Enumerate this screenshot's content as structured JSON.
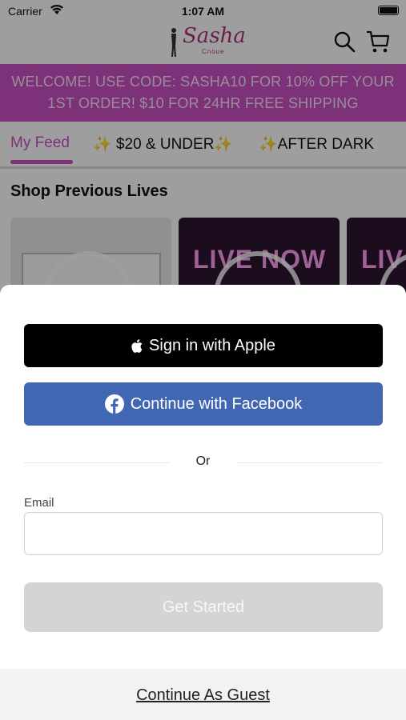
{
  "status_bar": {
    "carrier": "Carrier",
    "time": "1:07 AM"
  },
  "header": {
    "logo_text": "Sasha",
    "logo_subtext": "Cnoue"
  },
  "promo": {
    "line1": "WELCOME! USE CODE: SASHA10 FOR 10% OFF YOUR",
    "line2": "1ST ORDER! $10 FOR 24HR FREE SHIPPING"
  },
  "tabs": [
    {
      "label": "My Feed",
      "active": true
    },
    {
      "label": "✨ $20 & UNDER✨",
      "active": false
    },
    {
      "label": "✨AFTER DARK",
      "active": false
    }
  ],
  "section": {
    "title": "Shop Previous Lives"
  },
  "cards": [
    {
      "text": ""
    },
    {
      "text": "LIVE NOW"
    },
    {
      "text": "LIV"
    }
  ],
  "sheet": {
    "apple_label": "Sign in with Apple",
    "facebook_label": "Continue with Facebook",
    "or_text": "Or",
    "email_label": "Email",
    "email_value": "",
    "email_placeholder": "",
    "get_started_label": "Get Started",
    "guest_label": "Continue As Guest"
  },
  "colors": {
    "brand": "#c94fc4",
    "facebook": "#4267b2",
    "apple": "#000000",
    "disabled": "#d4d4d4"
  }
}
